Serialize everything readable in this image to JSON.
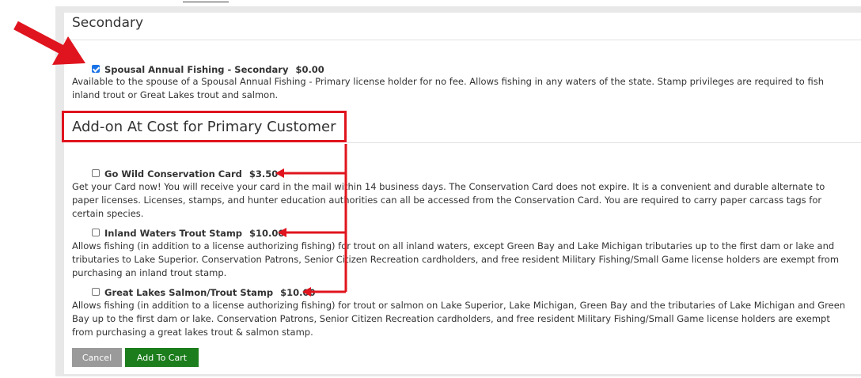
{
  "sections": {
    "secondary_heading": "Secondary",
    "addon_heading": "Add-on At Cost for Primary Customer"
  },
  "secondary_option": {
    "checked": true,
    "name": "Spousal Annual Fishing - Secondary",
    "price": "$0.00",
    "description": "Available to the spouse of a Spousal Annual Fishing - Primary license holder for no fee. Allows fishing in any waters of the state. Stamp privileges are required to fish inland trout or Great Lakes trout and salmon."
  },
  "addons": [
    {
      "checked": false,
      "name": "Go Wild Conservation Card",
      "price": "$3.50",
      "description": "Get your Card now! You will receive your card in the mail within 14 business days. The Conservation Card does not expire. It is a convenient and durable alternate to paper licenses. Licenses, stamps, and hunter education authorities can all be accessed from the Conservation Card. You are required to carry paper carcass tags for certain species."
    },
    {
      "checked": false,
      "name": "Inland Waters Trout Stamp",
      "price": "$10.00",
      "description": "Allows fishing (in addition to a license authorizing fishing) for trout on all inland waters, except Green Bay and Lake Michigan tributaries up to the first dam or lake and tributaries to Lake Superior. Conservation Patrons, Senior Citizen Recreation cardholders, and free resident Military Fishing/Small Game license holders are exempt from purchasing an inland trout stamp."
    },
    {
      "checked": false,
      "name": "Great Lakes Salmon/Trout Stamp",
      "price": "$10.00",
      "description": "Allows fishing (in addition to a license authorizing fishing) for trout or salmon on Lake Superior, Lake Michigan, Green Bay and the tributaries of Lake Michigan and Green Bay up to the first dam or lake. Conservation Patrons, Senior Citizen Recreation cardholders, and free resident Military Fishing/Small Game license holders are exempt from purchasing a great lakes trout & salmon stamp."
    }
  ],
  "buttons": {
    "cancel": "Cancel",
    "add_to_cart": "Add To Cart"
  },
  "colors": {
    "annotation_red": "#e0141e",
    "cart_green": "#1c7d1c",
    "cancel_gray": "#9a9a9a",
    "checkbox_blue": "#1a73e8"
  }
}
